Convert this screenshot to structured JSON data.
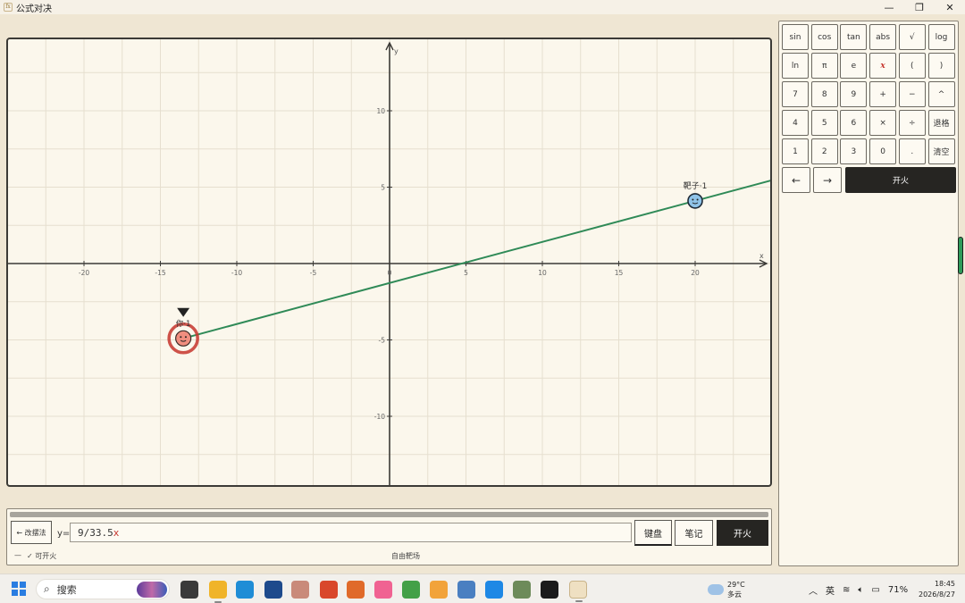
{
  "window": {
    "title": "公式对决",
    "icon_text": "fx",
    "controls": [
      "—",
      "❐",
      "✕"
    ]
  },
  "graph": {
    "x_axis_label": "x",
    "y_axis_label": "y",
    "x_ticks": [
      -20,
      -15,
      -10,
      -5,
      0,
      5,
      10,
      15,
      20
    ],
    "y_ticks": [
      -10,
      -5,
      5,
      10
    ],
    "x_range": [
      -25,
      25
    ],
    "y_range": [
      -14.5,
      14.5
    ],
    "grid_step": 2.5,
    "player": {
      "label": "你·1",
      "x": -13.5,
      "y": -4.9,
      "color": "#c6352d"
    },
    "target": {
      "label": "靶子·1",
      "x": 20,
      "y": 4.1,
      "color": "#2e6fb0"
    },
    "line": {
      "color": "#2f8a57",
      "slope": 0.2687,
      "intercept": -1.27
    }
  },
  "input": {
    "progress_fraction": 1.0,
    "back_label": "← 改摆法",
    "y_prefix": "y=",
    "formula_text": "9/33.5",
    "formula_var": "x",
    "keyboard_label": "键盘",
    "notes_label": "笔记",
    "fire_label": "开火",
    "status_dash": "—",
    "status_text": "✓ 可开火",
    "mode_label": "自由靶场"
  },
  "keypad": {
    "keys": [
      [
        "sin",
        "cos",
        "tan",
        "abs",
        "√",
        "log"
      ],
      [
        "ln",
        "π",
        "e",
        "x",
        "(",
        ")"
      ],
      [
        "7",
        "8",
        "9",
        "+",
        "−",
        "^"
      ],
      [
        "4",
        "5",
        "6",
        "×",
        "÷",
        "退格"
      ],
      [
        "1",
        "2",
        "3",
        "0",
        ".",
        "清空"
      ]
    ],
    "left_arrow": "←",
    "right_arrow": "→",
    "fire_label": "开火"
  },
  "taskbar": {
    "search_placeholder": "搜索",
    "weather_temp": "29°C",
    "weather_desc": "多云",
    "ime": "英",
    "battery": "71%",
    "time": "18:45",
    "date": "2026/8/27",
    "apps": [
      {
        "name": "task-view",
        "color": "#3a3a3a"
      },
      {
        "name": "file-explorer",
        "color": "#f0b429"
      },
      {
        "name": "edge",
        "color": "#1f8dd6"
      },
      {
        "name": "devtools",
        "color": "#1d4a8c"
      },
      {
        "name": "avatar-app",
        "color": "#c98a7a"
      },
      {
        "name": "foxit",
        "color": "#d9472b"
      },
      {
        "name": "app-orange",
        "color": "#e06a2a"
      },
      {
        "name": "bilibili",
        "color": "#f06292"
      },
      {
        "name": "app-green",
        "color": "#43a047"
      },
      {
        "name": "app-yellow",
        "color": "#f2a33a"
      },
      {
        "name": "app-gear",
        "color": "#4a7fc1"
      },
      {
        "name": "vscode",
        "color": "#1e88e5"
      },
      {
        "name": "app-tree",
        "color": "#6d8b5a"
      },
      {
        "name": "typora",
        "color": "#1b1b1b"
      },
      {
        "name": "formula-duel",
        "color": "#efe0c2"
      }
    ]
  }
}
